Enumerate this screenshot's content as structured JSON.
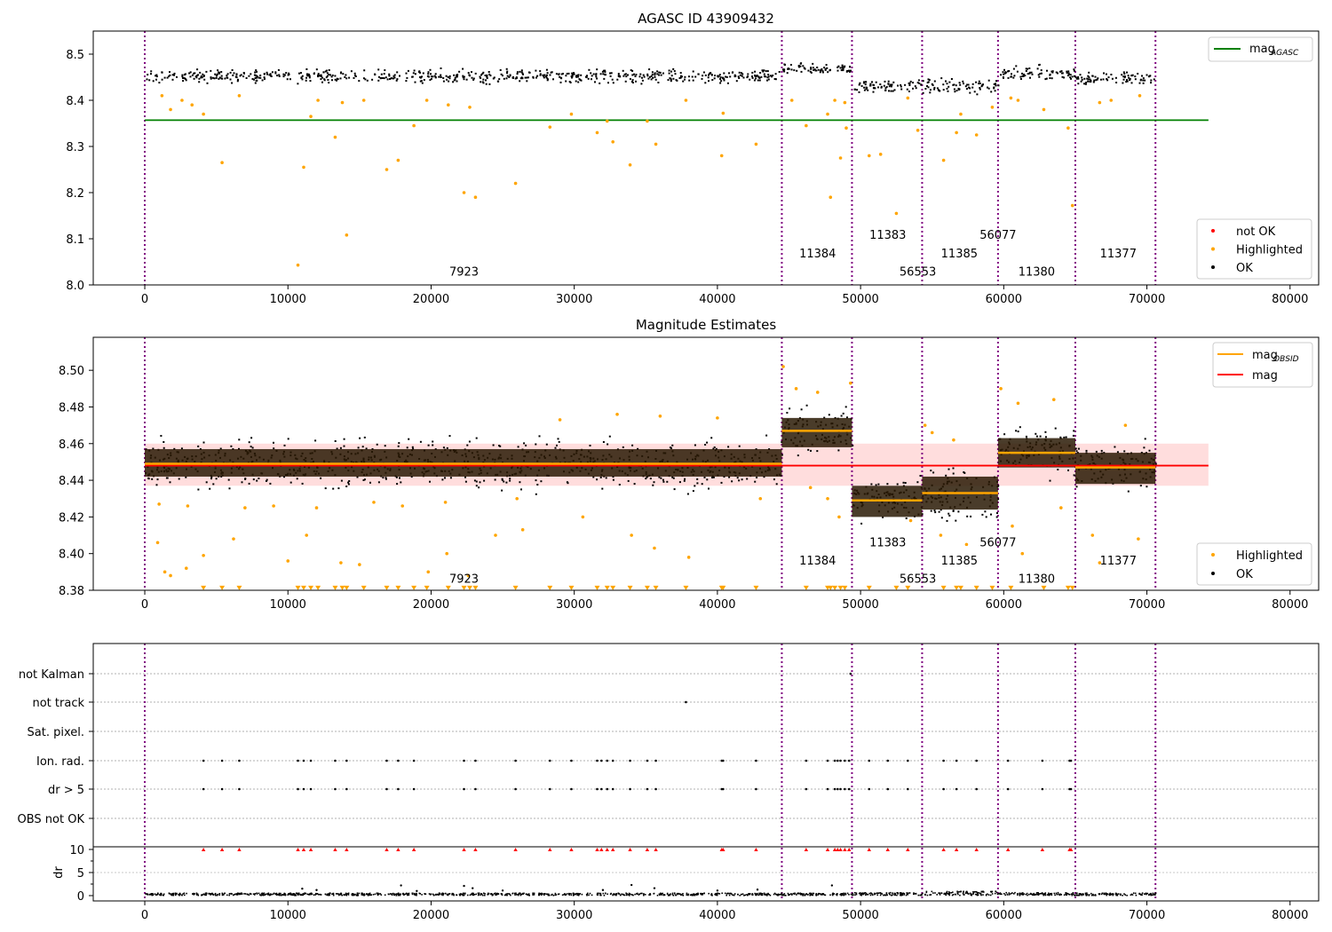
{
  "chart_data": [
    {
      "type": "scatter",
      "title": "AGASC ID 43909432",
      "xlim": [
        -3600,
        82000
      ],
      "ylim": [
        8.0,
        8.55
      ],
      "xticks": [
        0,
        10000,
        20000,
        30000,
        40000,
        50000,
        60000,
        70000,
        80000
      ],
      "yticks": [
        8.0,
        8.1,
        8.2,
        8.3,
        8.4,
        8.5
      ],
      "vlines": [
        0,
        44500,
        49400,
        54300,
        59600,
        65000,
        70600
      ],
      "hline": {
        "name": "mag_AGASC",
        "y": 8.357,
        "x": [
          0,
          74300
        ],
        "color": "#008000"
      },
      "obsid_labels": [
        {
          "text": "7923",
          "x": 22300,
          "y": 8.02
        },
        {
          "text": "11384",
          "x": 47000,
          "y": 8.06
        },
        {
          "text": "11383",
          "x": 51900,
          "y": 8.1
        },
        {
          "text": "56553",
          "x": 54000,
          "y": 8.02
        },
        {
          "text": "11385",
          "x": 56900,
          "y": 8.06
        },
        {
          "text": "56077",
          "x": 59600,
          "y": 8.1
        },
        {
          "text": "11380",
          "x": 62300,
          "y": 8.02
        },
        {
          "text": "11377",
          "x": 68000,
          "y": 8.06
        }
      ],
      "ok_band": [
        {
          "x0": 0,
          "x1": 44500,
          "y0": 8.432,
          "y1": 8.472
        },
        {
          "x0": 44500,
          "x1": 49400,
          "y0": 8.45,
          "y1": 8.485
        },
        {
          "x0": 49400,
          "x1": 54300,
          "y0": 8.41,
          "y1": 8.45
        },
        {
          "x0": 54300,
          "x1": 59600,
          "y0": 8.405,
          "y1": 8.455
        },
        {
          "x0": 59600,
          "x1": 65000,
          "y0": 8.435,
          "y1": 8.48
        },
        {
          "x0": 65000,
          "x1": 70600,
          "y0": 8.43,
          "y1": 8.465
        }
      ],
      "highlighted": [
        [
          1200,
          8.41
        ],
        [
          1800,
          8.38
        ],
        [
          2600,
          8.4
        ],
        [
          3300,
          8.39
        ],
        [
          4100,
          8.37
        ],
        [
          5400,
          8.265
        ],
        [
          6600,
          8.41
        ],
        [
          10700,
          8.043
        ],
        [
          11100,
          8.255
        ],
        [
          11600,
          8.365
        ],
        [
          12100,
          8.4
        ],
        [
          13300,
          8.32
        ],
        [
          13800,
          8.395
        ],
        [
          14100,
          8.108
        ],
        [
          15300,
          8.4
        ],
        [
          16900,
          8.25
        ],
        [
          17700,
          8.27
        ],
        [
          18800,
          8.345
        ],
        [
          19700,
          8.4
        ],
        [
          21200,
          8.39
        ],
        [
          22300,
          8.2
        ],
        [
          22700,
          8.385
        ],
        [
          23100,
          8.19
        ],
        [
          25900,
          8.22
        ],
        [
          28300,
          8.342
        ],
        [
          29800,
          8.37
        ],
        [
          31600,
          8.33
        ],
        [
          32300,
          8.355
        ],
        [
          32700,
          8.31
        ],
        [
          33900,
          8.26
        ],
        [
          35100,
          8.355
        ],
        [
          35700,
          8.305
        ],
        [
          37800,
          8.4
        ],
        [
          40300,
          8.28
        ],
        [
          40400,
          8.372
        ],
        [
          42700,
          8.305
        ],
        [
          45200,
          8.4
        ],
        [
          46200,
          8.345
        ],
        [
          47700,
          8.37
        ],
        [
          47900,
          8.19
        ],
        [
          48200,
          8.4
        ],
        [
          48600,
          8.275
        ],
        [
          48900,
          8.395
        ],
        [
          49000,
          8.34
        ],
        [
          50600,
          8.28
        ],
        [
          51400,
          8.283
        ],
        [
          52500,
          8.155
        ],
        [
          53300,
          8.405
        ],
        [
          54000,
          8.335
        ],
        [
          55800,
          8.27
        ],
        [
          56700,
          8.33
        ],
        [
          57000,
          8.37
        ],
        [
          58100,
          8.325
        ],
        [
          59200,
          8.385
        ],
        [
          60500,
          8.405
        ],
        [
          61000,
          8.4
        ],
        [
          62800,
          8.38
        ],
        [
          64500,
          8.34
        ],
        [
          64800,
          8.172
        ],
        [
          66700,
          8.395
        ],
        [
          67500,
          8.4
        ],
        [
          69500,
          8.41
        ]
      ],
      "legend_line": {
        "label": "mag",
        "sub": "AGASC"
      },
      "legend_points": [
        {
          "label": "not OK",
          "color": "#ff0000"
        },
        {
          "label": "Highlighted",
          "color": "#ffa500"
        },
        {
          "label": "OK",
          "color": "#000000"
        }
      ]
    },
    {
      "type": "scatter",
      "title": "Magnitude Estimates",
      "xlim": [
        -3600,
        82000
      ],
      "ylim": [
        8.38,
        8.518
      ],
      "xticks": [
        0,
        10000,
        20000,
        30000,
        40000,
        50000,
        60000,
        70000,
        80000
      ],
      "yticks": [
        8.38,
        8.4,
        8.42,
        8.44,
        8.46,
        8.48,
        8.5
      ],
      "ytick_labels": [
        "8.38",
        "8.40",
        "8.42",
        "8.44",
        "8.46",
        "8.48",
        "8.50"
      ],
      "vlines": [
        0,
        44500,
        49400,
        54300,
        59600,
        65000,
        70600
      ],
      "mag_line": {
        "name": "mag",
        "y": 8.448,
        "x": [
          0,
          74300
        ],
        "band": [
          8.437,
          8.46
        ],
        "color": "#ff0000"
      },
      "obsid_segments": [
        {
          "x0": 0,
          "x1": 44500,
          "mag": 8.449,
          "box": [
            8.442,
            8.457
          ],
          "ok": [
            8.43,
            8.468
          ]
        },
        {
          "x0": 44500,
          "x1": 49400,
          "mag": 8.467,
          "box": [
            8.458,
            8.474
          ],
          "ok": [
            8.45,
            8.483
          ]
        },
        {
          "x0": 49400,
          "x1": 54300,
          "mag": 8.429,
          "box": [
            8.42,
            8.437
          ],
          "ok": [
            8.413,
            8.446
          ]
        },
        {
          "x0": 54300,
          "x1": 59600,
          "mag": 8.433,
          "box": [
            8.424,
            8.442
          ],
          "ok": [
            8.412,
            8.452
          ]
        },
        {
          "x0": 59600,
          "x1": 65000,
          "mag": 8.455,
          "box": [
            8.447,
            8.463
          ],
          "ok": [
            8.437,
            8.476
          ]
        },
        {
          "x0": 65000,
          "x1": 70600,
          "mag": 8.447,
          "box": [
            8.438,
            8.455
          ],
          "ok": [
            8.43,
            8.466
          ]
        }
      ],
      "obsid_labels": [
        {
          "text": "7923",
          "x": 22300,
          "y": 8.384
        },
        {
          "text": "11384",
          "x": 47000,
          "y": 8.394
        },
        {
          "text": "11383",
          "x": 51900,
          "y": 8.404
        },
        {
          "text": "56553",
          "x": 54000,
          "y": 8.384
        },
        {
          "text": "11385",
          "x": 56900,
          "y": 8.394
        },
        {
          "text": "56077",
          "x": 59600,
          "y": 8.404
        },
        {
          "text": "11380",
          "x": 62300,
          "y": 8.384
        },
        {
          "text": "11377",
          "x": 68000,
          "y": 8.394
        }
      ],
      "highlighted": [
        [
          900,
          8.406
        ],
        [
          1400,
          8.39
        ],
        [
          1800,
          8.388
        ],
        [
          2900,
          8.392
        ],
        [
          4100,
          8.399
        ],
        [
          6200,
          8.408
        ],
        [
          10000,
          8.396
        ],
        [
          11300,
          8.41
        ],
        [
          13700,
          8.395
        ],
        [
          15000,
          8.394
        ],
        [
          19800,
          8.39
        ],
        [
          21100,
          8.4
        ],
        [
          22600,
          8.388
        ],
        [
          24500,
          8.41
        ],
        [
          26400,
          8.413
        ],
        [
          30600,
          8.42
        ],
        [
          34000,
          8.41
        ],
        [
          35600,
          8.403
        ],
        [
          38000,
          8.398
        ],
        [
          43000,
          8.43
        ],
        [
          46500,
          8.436
        ],
        [
          47700,
          8.43
        ],
        [
          48500,
          8.42
        ],
        [
          53500,
          8.418
        ],
        [
          55600,
          8.41
        ],
        [
          57400,
          8.405
        ],
        [
          60600,
          8.415
        ],
        [
          61300,
          8.4
        ],
        [
          64000,
          8.425
        ],
        [
          66200,
          8.41
        ],
        [
          66700,
          8.395
        ],
        [
          69400,
          8.408
        ],
        [
          1000,
          8.427
        ],
        [
          3000,
          8.426
        ],
        [
          7000,
          8.425
        ],
        [
          9000,
          8.426
        ],
        [
          12000,
          8.425
        ],
        [
          16000,
          8.428
        ],
        [
          18000,
          8.426
        ],
        [
          21000,
          8.428
        ],
        [
          26000,
          8.43
        ],
        [
          29000,
          8.473
        ],
        [
          33000,
          8.476
        ],
        [
          36000,
          8.475
        ],
        [
          40000,
          8.474
        ],
        [
          44600,
          8.502
        ],
        [
          45500,
          8.49
        ],
        [
          47000,
          8.488
        ],
        [
          49300,
          8.493
        ],
        [
          54500,
          8.47
        ],
        [
          55000,
          8.466
        ],
        [
          56500,
          8.462
        ],
        [
          59800,
          8.49
        ],
        [
          61000,
          8.482
        ],
        [
          63500,
          8.484
        ],
        [
          68500,
          8.47
        ]
      ],
      "lower_limit_y": 8.381,
      "lower_limits": [
        4100,
        5400,
        6600,
        10700,
        11100,
        11600,
        12100,
        13300,
        13800,
        14100,
        15300,
        16900,
        17700,
        18800,
        19700,
        21200,
        22300,
        22700,
        23100,
        25900,
        28300,
        29800,
        31600,
        32300,
        32700,
        33900,
        35100,
        35700,
        37800,
        40300,
        40400,
        42700,
        46200,
        47700,
        47900,
        48200,
        48600,
        48900,
        50600,
        52500,
        53300,
        55800,
        56700,
        57000,
        58100,
        59200,
        60500,
        62800,
        64500,
        64800
      ],
      "legend_lines": [
        {
          "label": "mag",
          "sub": "OBSID",
          "color": "#ffa500"
        },
        {
          "label": "mag",
          "sub": "",
          "color": "#ff0000"
        }
      ],
      "legend_points": [
        {
          "label": "Highlighted",
          "color": "#ffa500"
        },
        {
          "label": "OK",
          "color": "#000000"
        }
      ]
    },
    {
      "type": "scatter",
      "title": "",
      "xlim": [
        -3600,
        82000
      ],
      "xticks": [
        0,
        10000,
        20000,
        30000,
        40000,
        50000,
        60000,
        70000,
        80000
      ],
      "vlines": [
        0,
        44500,
        49400,
        54300,
        59600,
        65000,
        70600
      ],
      "categories": [
        "not Kalman",
        "not track",
        "Sat. pixel.",
        "Ion. rad.",
        "dr > 5",
        "OBS not OK"
      ],
      "flag_points": {
        "not Kalman": [
          49300
        ],
        "not track": [
          37800
        ],
        "Sat. pixel.": [],
        "Ion. rad.": [
          4100,
          5400,
          6600,
          10700,
          11100,
          11600,
          13300,
          14100,
          16900,
          17700,
          18800,
          22300,
          23100,
          25900,
          28300,
          29800,
          31600,
          31900,
          32300,
          32700,
          33900,
          35100,
          35700,
          40300,
          40400,
          42700,
          46200,
          47700,
          48200,
          48400,
          48600,
          48900,
          49200,
          50600,
          51900,
          53300,
          55800,
          56700,
          58100,
          60300,
          62700,
          64600,
          64700
        ],
        "dr > 5": [
          4100,
          5400,
          6600,
          10700,
          11100,
          11600,
          13300,
          14100,
          16900,
          17700,
          18800,
          22300,
          23100,
          25900,
          28300,
          29800,
          31600,
          31900,
          32300,
          32700,
          33900,
          35100,
          35700,
          40300,
          40400,
          42700,
          46200,
          47700,
          48200,
          48400,
          48600,
          48900,
          49200,
          50600,
          51900,
          53300,
          55800,
          56700,
          58100,
          60300,
          62700,
          64600,
          64700
        ],
        "OBS not OK": []
      },
      "dr_axis": {
        "label": "dr",
        "yticks": [
          0,
          5,
          10
        ],
        "clip_value": 10,
        "clipped_x": [
          4100,
          5400,
          6600,
          10700,
          11100,
          11600,
          13300,
          14100,
          16900,
          17700,
          18800,
          22300,
          23100,
          25900,
          28300,
          29800,
          31600,
          31900,
          32300,
          32700,
          33900,
          35100,
          35700,
          40300,
          40400,
          42700,
          46200,
          47700,
          48200,
          48400,
          48600,
          48900,
          49200,
          50600,
          51900,
          53300,
          55800,
          56700,
          58100,
          60300,
          62700,
          64600,
          64700
        ]
      },
      "dr_points": [
        [
          11000,
          1.5
        ],
        [
          12000,
          1.2
        ],
        [
          17900,
          2.2
        ],
        [
          19000,
          1.0
        ],
        [
          22300,
          2.1
        ],
        [
          22900,
          1.6
        ],
        [
          25000,
          1.1
        ],
        [
          32000,
          1.2
        ],
        [
          34000,
          2.3
        ],
        [
          35600,
          1.6
        ],
        [
          40000,
          1.1
        ],
        [
          42800,
          1.3
        ],
        [
          48000,
          2.2
        ]
      ]
    }
  ]
}
